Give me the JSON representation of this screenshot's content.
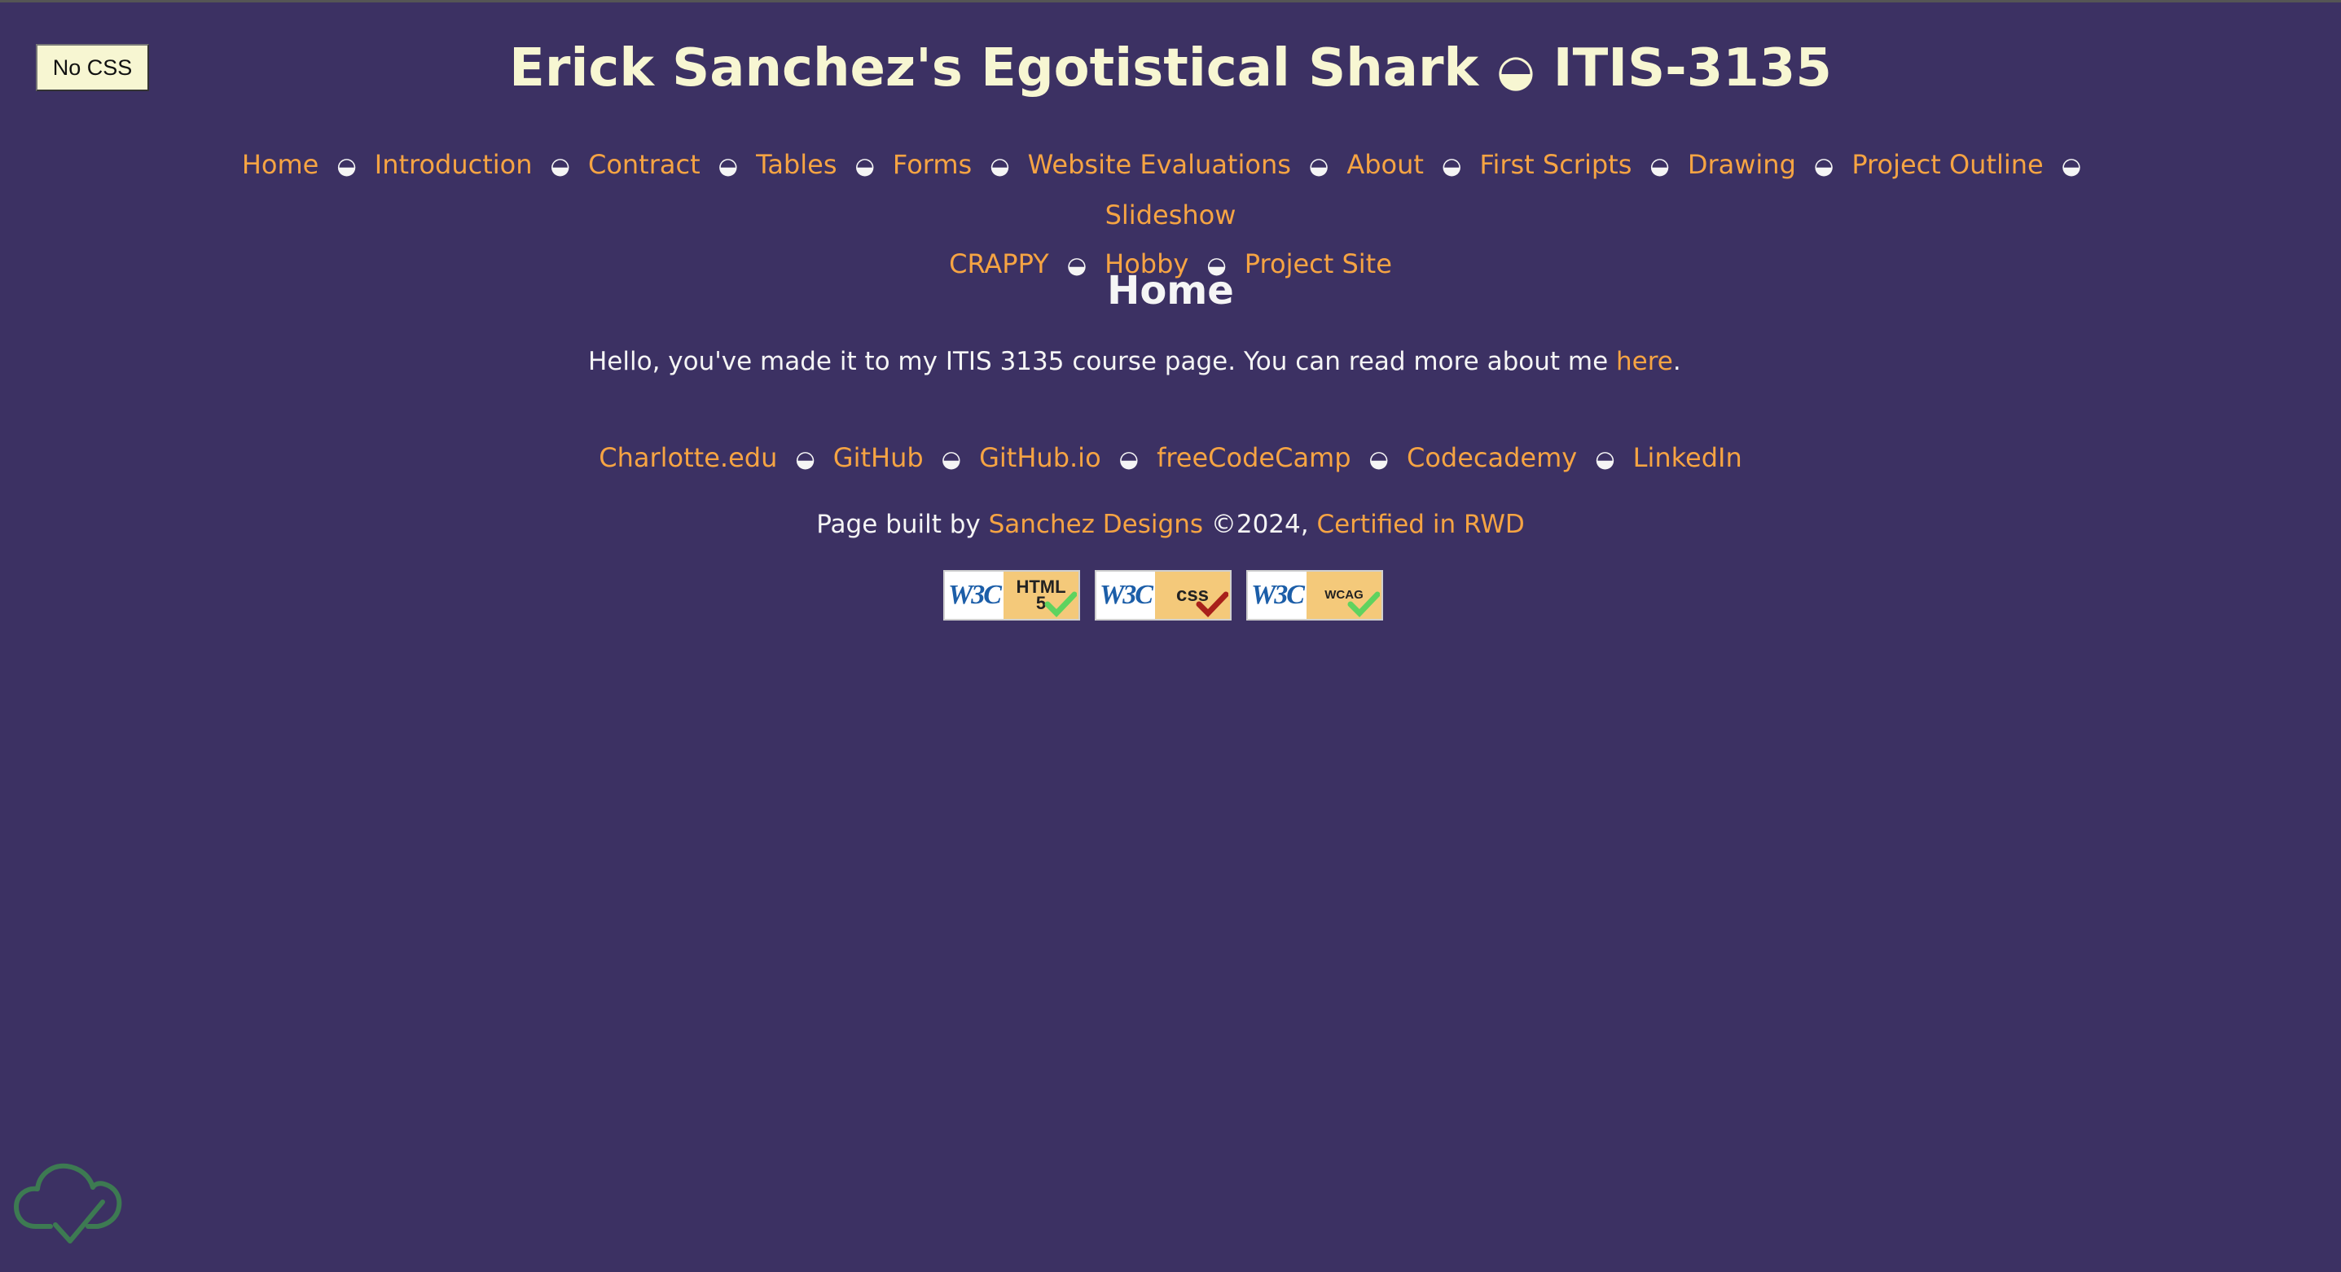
{
  "no_css_button": "No CSS",
  "header": {
    "title_left": "Erick Sanchez's Egotistical Shark",
    "title_symbol": "◒",
    "title_right": "ITIS-3135"
  },
  "nav": {
    "separator": "◒",
    "items": [
      "Home",
      "Introduction",
      "Contract",
      "Tables",
      "Forms",
      "Website Evaluations",
      "About",
      "First Scripts",
      "Drawing",
      "Project Outline",
      "Slideshow",
      "CRAPPY",
      "Hobby",
      "Project Site"
    ]
  },
  "main": {
    "heading": "Home",
    "intro_text": "Hello, you've made it to my ITIS 3135 course page. You can read more about me ",
    "intro_link": "here",
    "intro_end": "."
  },
  "footer": {
    "links": [
      "Charlotte.edu",
      "GitHub",
      "GitHub.io",
      "freeCodeCamp",
      "Codecademy",
      "LinkedIn"
    ],
    "built_prefix": "Page built by ",
    "built_link": "Sanchez Designs",
    "built_mid": " ©2024, ",
    "certified_link": "Certified in RWD"
  },
  "badges": [
    {
      "logo": "W3C",
      "label_line1": "HTML",
      "label_line2": "5",
      "check_color": "#5fd35f"
    },
    {
      "logo": "W3C",
      "label_line1": "css",
      "label_line2": "",
      "check_color": "#a8201a"
    },
    {
      "logo": "W3C",
      "label_line1": "WCAG",
      "label_line2": "",
      "check_color": "#5fd35f"
    }
  ],
  "colors": {
    "background": "#3c3163",
    "link": "#f6a443",
    "title": "#f7f6d2",
    "cloud_icon": "#3d7a52"
  },
  "icons": {
    "cloud": "cloud-check-icon"
  }
}
